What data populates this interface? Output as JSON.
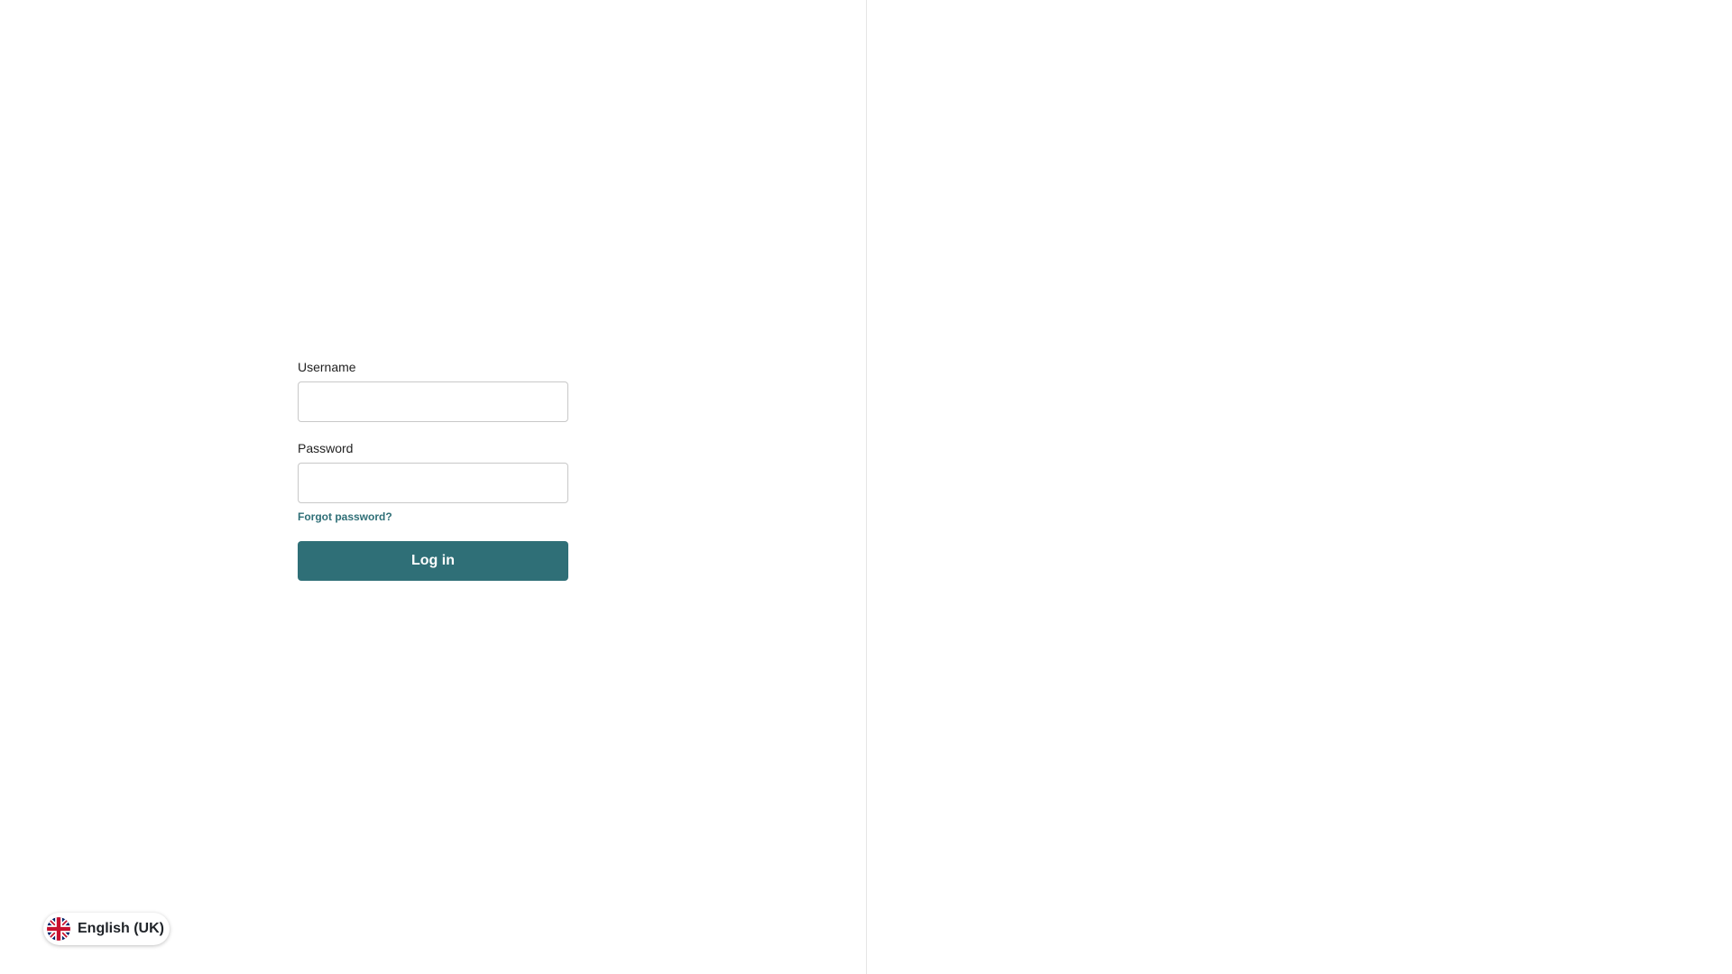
{
  "login": {
    "username_label": "Username",
    "username_value": "",
    "password_label": "Password",
    "password_value": "",
    "forgot_password": "Forgot password?",
    "submit_label": "Log in"
  },
  "language": {
    "current": "English (UK)",
    "icon": "uk-flag-icon"
  },
  "colors": {
    "accent": "#2f6f77",
    "divider": "#e6e6e6"
  }
}
